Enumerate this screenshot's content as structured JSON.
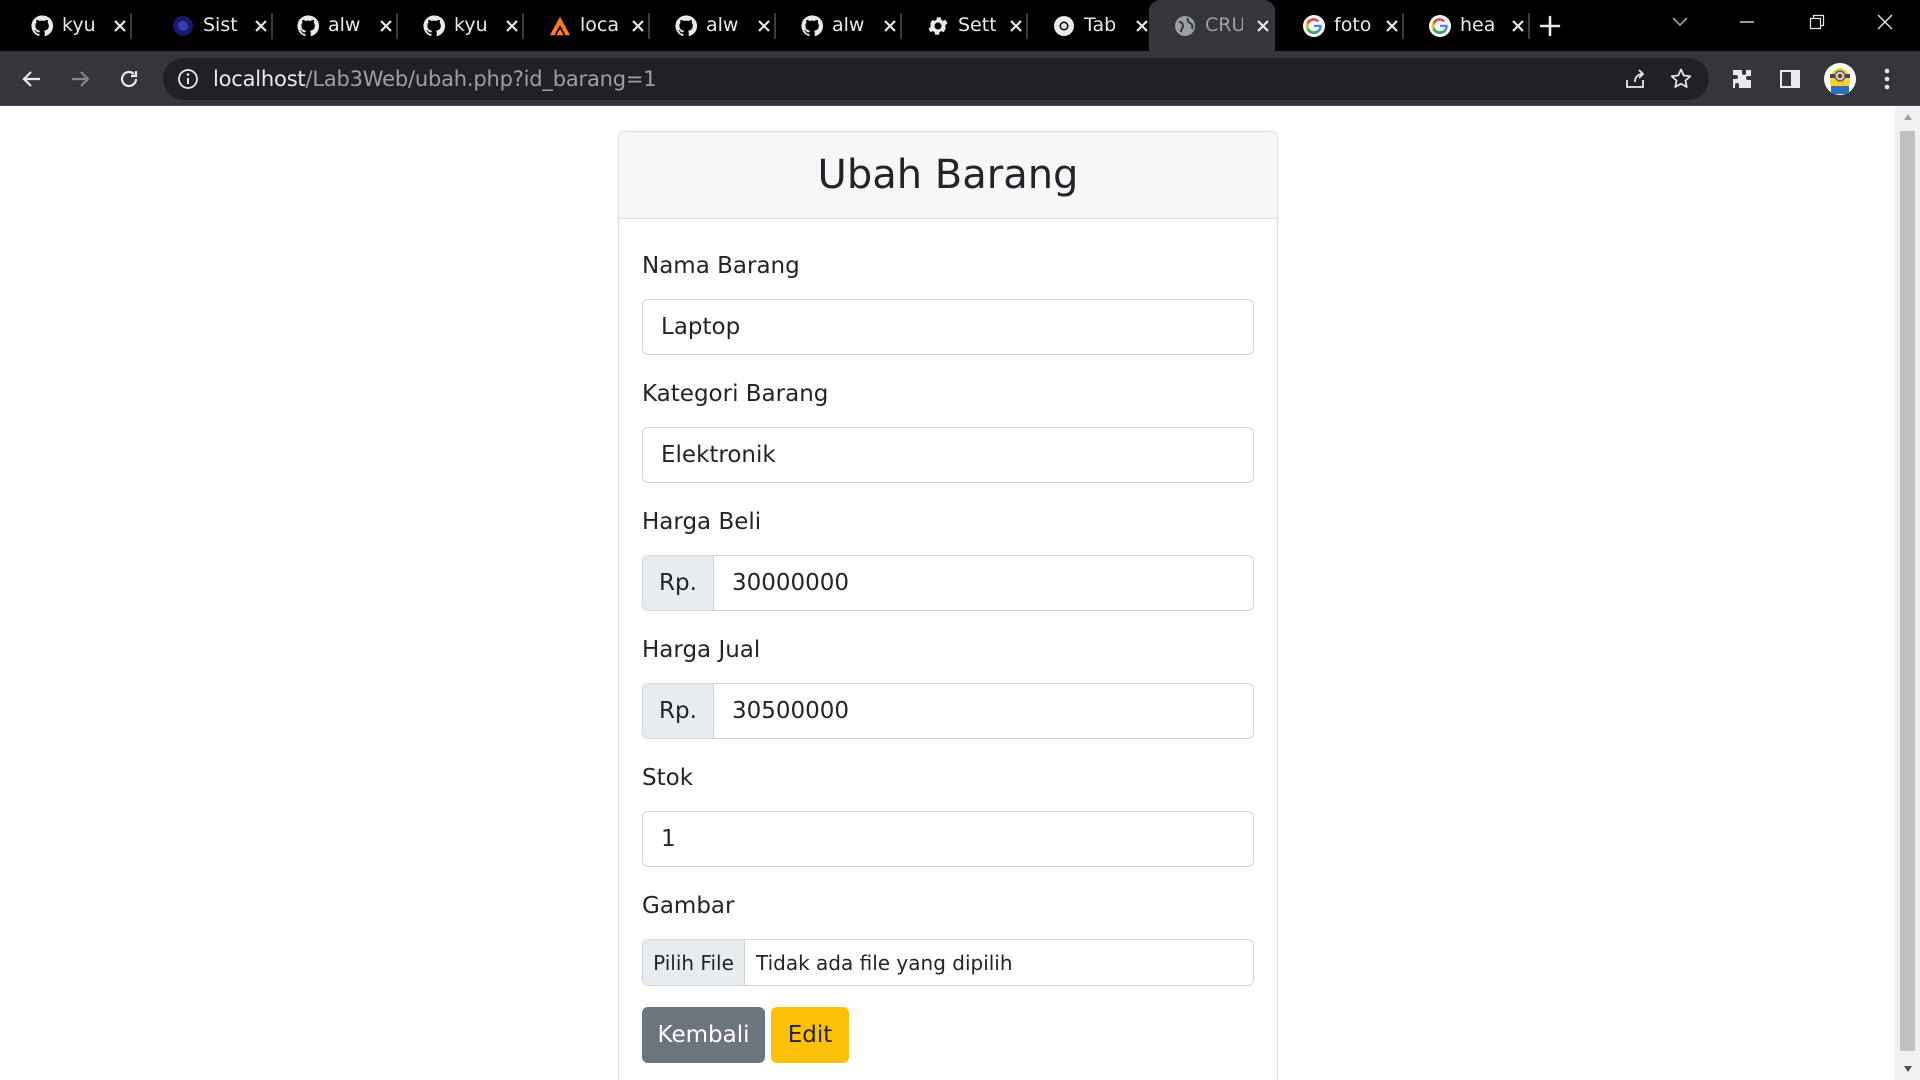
{
  "browser": {
    "tabs": [
      {
        "title": "kyu",
        "icon": "github-icon",
        "active": false
      },
      {
        "title": "Sist",
        "icon": "globe-dark-icon",
        "active": false
      },
      {
        "title": "alw",
        "icon": "github-icon",
        "active": false
      },
      {
        "title": "kyu",
        "icon": "github-icon",
        "active": false
      },
      {
        "title": "loca",
        "icon": "xampp-icon",
        "active": false
      },
      {
        "title": "alw",
        "icon": "github-icon",
        "active": false
      },
      {
        "title": "alw",
        "icon": "github-icon",
        "active": false
      },
      {
        "title": "Sett",
        "icon": "gear-icon",
        "active": false
      },
      {
        "title": "Tab",
        "icon": "chrome-icon",
        "active": false
      },
      {
        "title": "CRU",
        "icon": "globe-icon",
        "active": true
      },
      {
        "title": "foto",
        "icon": "google-icon",
        "active": false
      },
      {
        "title": "hea",
        "icon": "google-icon",
        "active": false
      }
    ],
    "url_host": "localhost",
    "url_path": "/Lab3Web/ubah.php?id_barang=1"
  },
  "form": {
    "title": "Ubah Barang",
    "fields": {
      "nama": {
        "label": "Nama Barang",
        "value": "Laptop"
      },
      "kategori": {
        "label": "Kategori Barang",
        "value": "Elektronik"
      },
      "harga_beli": {
        "label": "Harga Beli",
        "prefix": "Rp.",
        "value": "30000000"
      },
      "harga_jual": {
        "label": "Harga Jual",
        "prefix": "Rp.",
        "value": "30500000"
      },
      "stok": {
        "label": "Stok",
        "value": "1"
      },
      "gambar": {
        "label": "Gambar",
        "button": "Pilih File",
        "status": "Tidak ada file yang dipilih"
      }
    },
    "buttons": {
      "back": "Kembali",
      "edit": "Edit"
    }
  },
  "colors": {
    "secondary": "#6c757d",
    "warning": "#ffc107",
    "tabbar": "#000000",
    "toolbar": "#35363a"
  }
}
